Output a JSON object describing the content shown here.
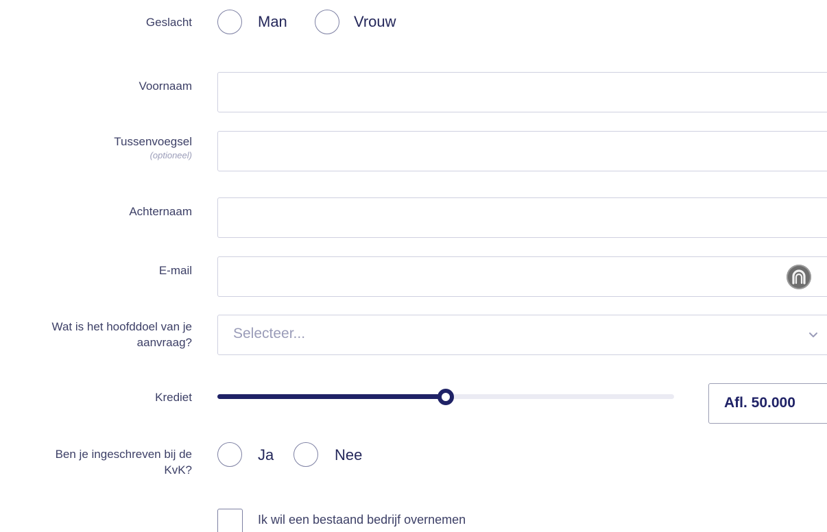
{
  "gender": {
    "label": "Geslacht",
    "options": [
      "Man",
      "Vrouw"
    ]
  },
  "first_name": {
    "label": "Voornaam",
    "value": ""
  },
  "infix": {
    "label": "Tussenvoegsel",
    "optional_hint": "(optioneel)",
    "value": ""
  },
  "last_name": {
    "label": "Achternaam",
    "value": ""
  },
  "email": {
    "label": "E-mail",
    "value": "",
    "icon": "password-manager-icon"
  },
  "purpose": {
    "label_line1": "Wat is het hoofddoel van je",
    "label_line2": "aanvraag?",
    "placeholder": "Selecteer...",
    "icon": "chevron-down-icon"
  },
  "credit": {
    "label": "Krediet",
    "amount": "Afl. 50.000",
    "slider_fraction": 0.5
  },
  "kvk": {
    "label_line1": "Ben je ingeschreven bij de",
    "label_line2": "KvK?",
    "options": [
      "Ja",
      "Nee"
    ]
  },
  "takeover": {
    "label": "Ik wil een bestaand bedrijf overnemen"
  },
  "colors": {
    "accent": "#1f2266",
    "border": "#cfd0e0",
    "label": "#3c3f66",
    "placeholder": "#9a9cb8"
  }
}
